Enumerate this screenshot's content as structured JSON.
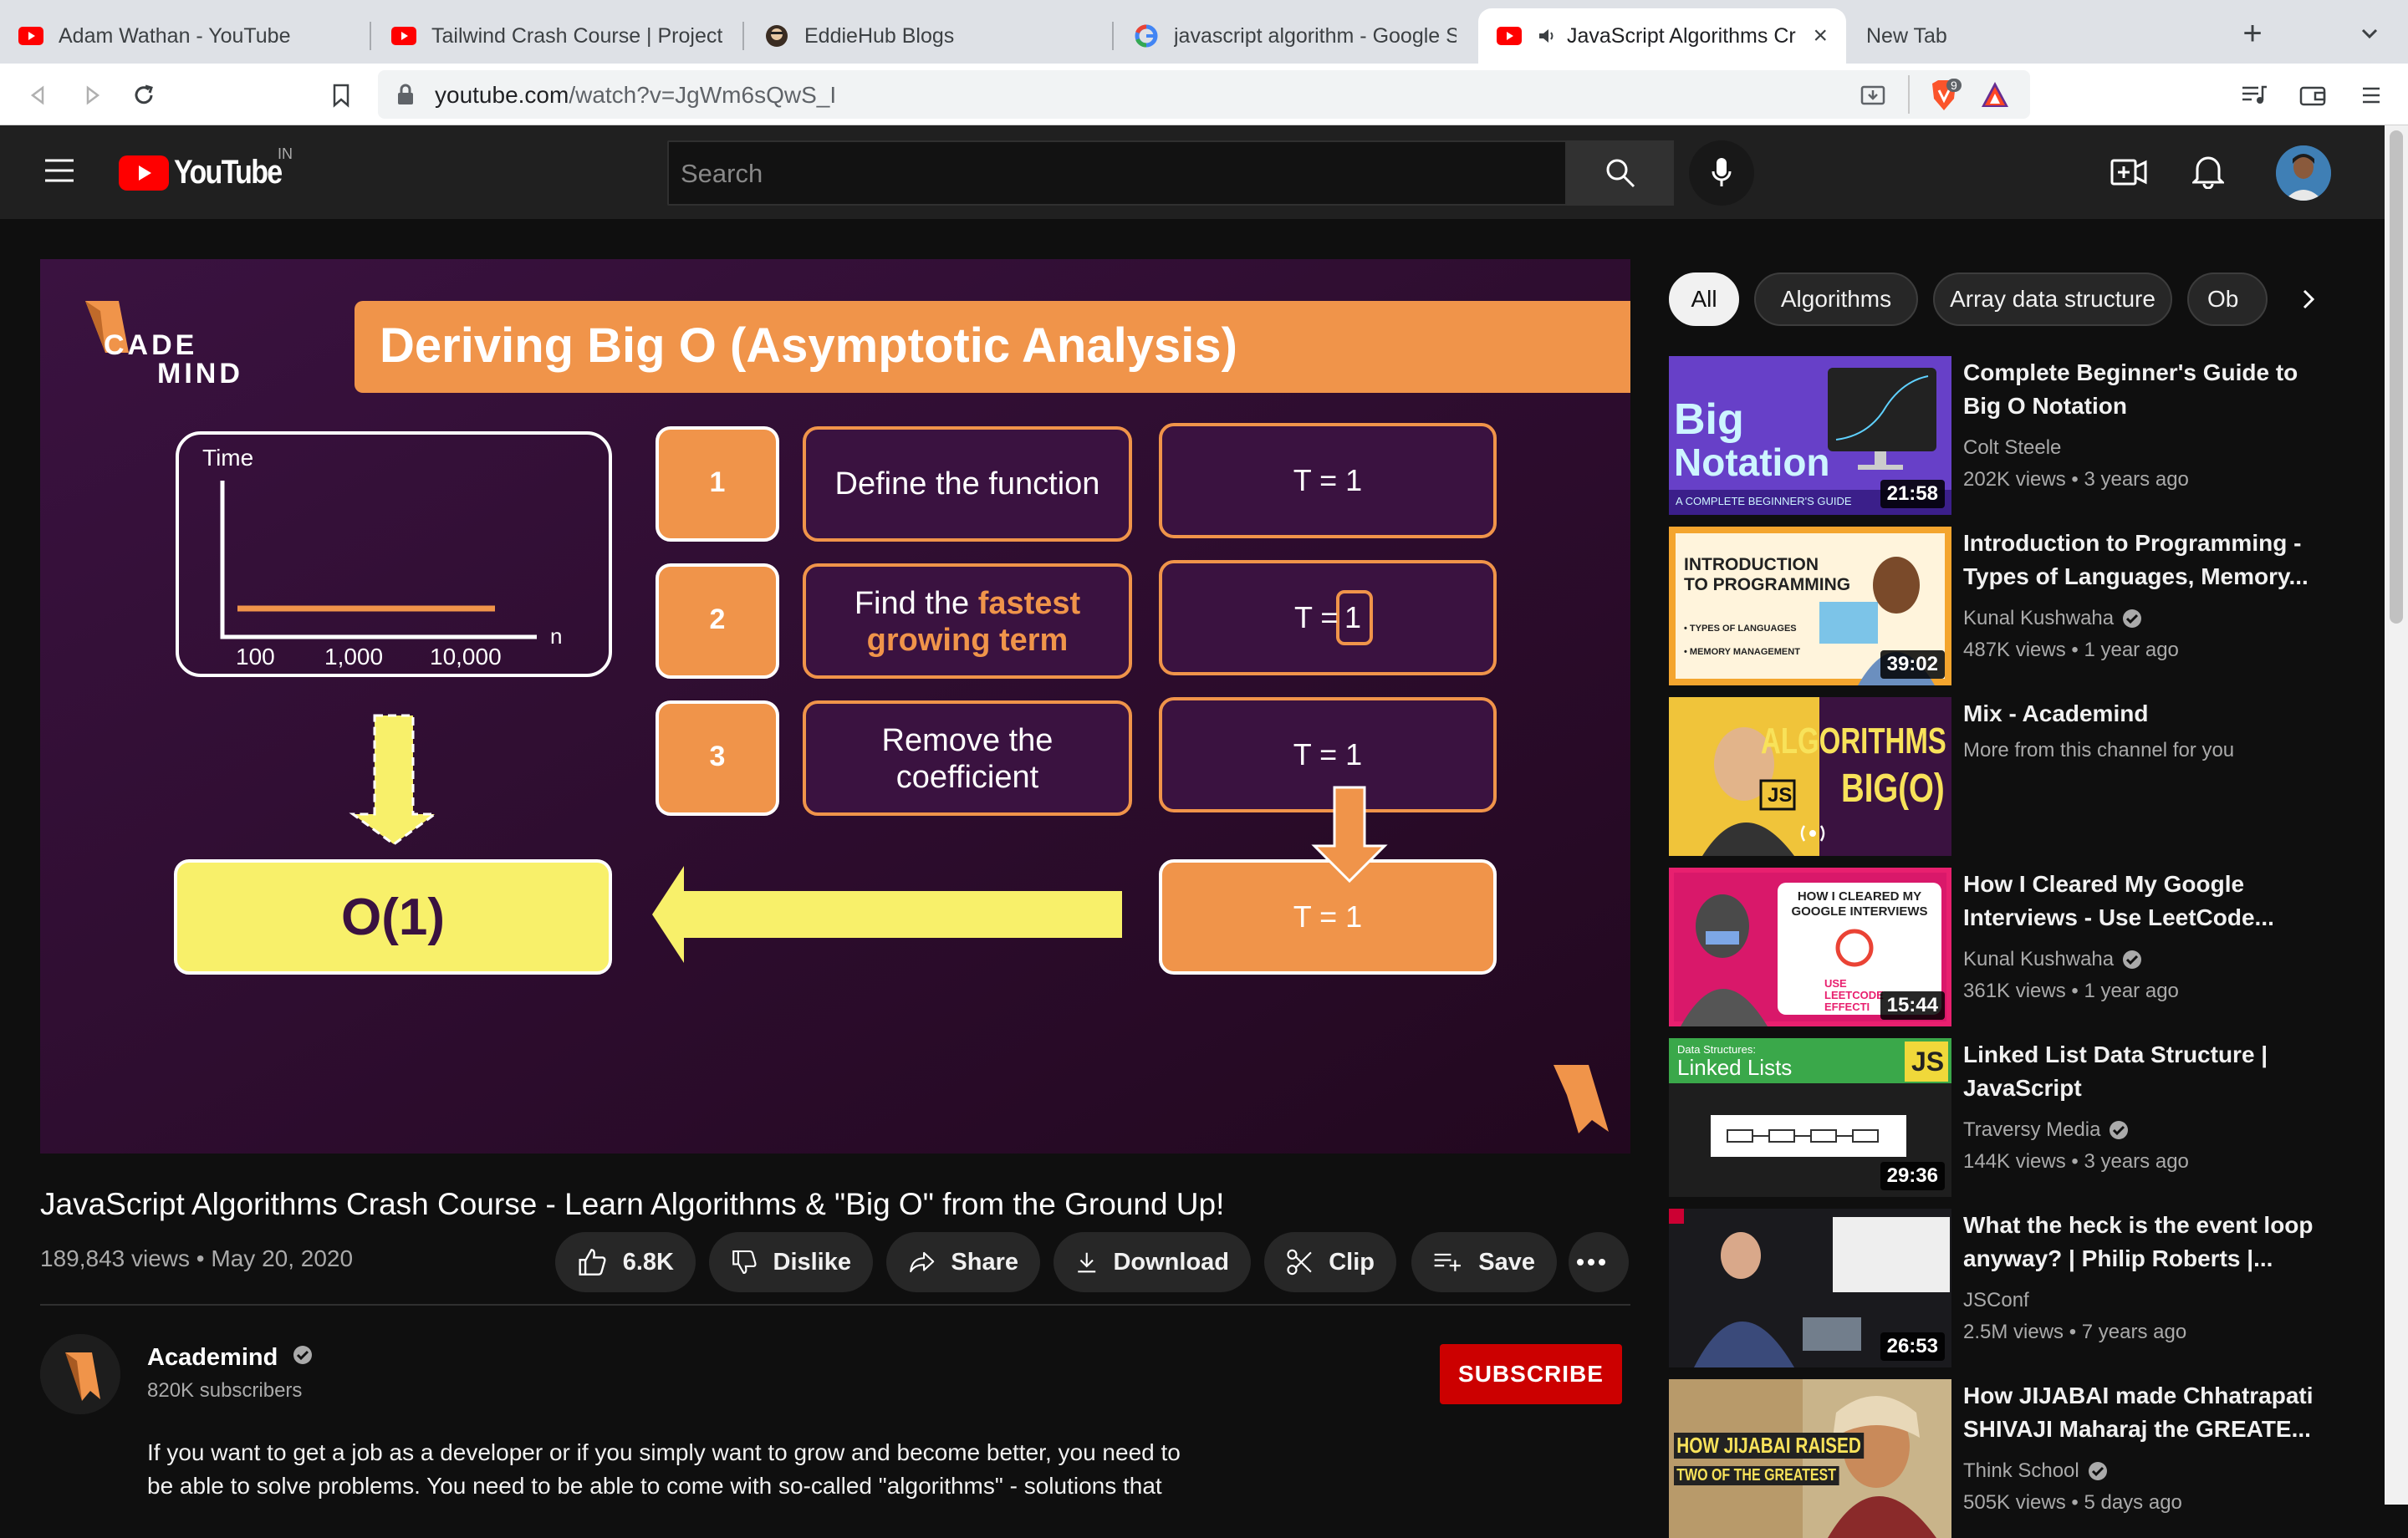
{
  "browser": {
    "tabs": [
      {
        "title": "Adam Wathan - YouTube",
        "favicon": "youtube-icon"
      },
      {
        "title": "Tailwind Crash Course | Project F",
        "favicon": "youtube-icon"
      },
      {
        "title": "EddieHub Blogs",
        "favicon": "eddiehub-icon"
      },
      {
        "title": "javascript algorithm - Google Se",
        "favicon": "google-icon"
      },
      {
        "title": "JavaScript Algorithms Cr",
        "favicon": "youtube-icon",
        "active": true,
        "audio": true
      },
      {
        "title": "New Tab",
        "favicon": ""
      }
    ],
    "url_host": "youtube.com",
    "url_path": "/watch?v=JgWm6sQwS_I",
    "shield_badge": "9"
  },
  "header": {
    "logo_text": "YouTube",
    "country": "IN",
    "search_placeholder": "Search"
  },
  "slide": {
    "brand_top": "CADE",
    "brand_bottom": "MIND",
    "title": "Deriving Big O (Asymptotic Analysis)",
    "graph_ylabel": "Time",
    "graph_xlabel": "n",
    "graph_ticks": [
      "100",
      "1,000",
      "10,000"
    ],
    "steps": [
      {
        "num": "1",
        "label_a": "Define the function",
        "label_b": "",
        "label_c": "",
        "expr": "T = 1"
      },
      {
        "num": "2",
        "label_a": "Find the ",
        "label_b": "fastest",
        "label_c": "growing term",
        "expr": "T = ",
        "expr_box": "1"
      },
      {
        "num": "3",
        "label_a": "Remove the",
        "label_b": "coefficient",
        "label_c": "",
        "expr": "T = 1"
      }
    ],
    "final_expr": "T = 1",
    "result": "O(1)"
  },
  "video": {
    "title": "JavaScript Algorithms Crash Course - Learn Algorithms & \"Big O\" from the Ground Up!",
    "views": "189,843 views",
    "date": "May 20, 2020",
    "likes": "6.8K",
    "dislike_label": "Dislike",
    "share_label": "Share",
    "download_label": "Download",
    "clip_label": "Clip",
    "save_label": "Save"
  },
  "channel": {
    "name": "Academind",
    "subscribers": "820K subscribers",
    "subscribe_label": "SUBSCRIBE"
  },
  "description": "If you want to get a job as a developer or if you simply want to grow and become better, you need to be able to solve problems. You need to be able to come with so-called \"algorithms\" - solutions that",
  "chips": [
    "All",
    "Algorithms",
    "Array data structure",
    "Ob"
  ],
  "recommendations": [
    {
      "title_1": "Complete Beginner's Guide to",
      "title_2": "Big O Notation",
      "channel": "Colt Steele",
      "verified": false,
      "meta": "202K views • 3 years ago",
      "duration": "21:58",
      "thumb_text_1": "Big",
      "thumb_text_2": "Notation",
      "thumb_text_3": "A COMPLETE BEGINNER'S GUIDE"
    },
    {
      "title_1": "Introduction to Programming -",
      "title_2": "Types of Languages, Memory...",
      "channel": "Kunal Kushwaha",
      "verified": true,
      "meta": "487K views • 1 year ago",
      "duration": "39:02",
      "thumb_text_1": "INTRODUCTION",
      "thumb_text_2": "TO PROGRAMMING",
      "thumb_text_3": "• TYPES OF LANGUAGES",
      "thumb_text_4": "• MEMORY MANAGEMENT"
    },
    {
      "title_1": "Mix - Academind",
      "title_2": "",
      "channel": "More from this channel for you",
      "verified": false,
      "meta": "",
      "duration": "",
      "thumb_text_1": "ALGORITHMS",
      "thumb_text_2": "BIG(O)",
      "thumb_text_3": "JS"
    },
    {
      "title_1": "How I Cleared My Google",
      "title_2": "Interviews - Use LeetCode...",
      "channel": "Kunal Kushwaha",
      "verified": true,
      "meta": "361K views • 1 year ago",
      "duration": "15:44",
      "thumb_text_1": "HOW I CLEARED MY",
      "thumb_text_2": "GOOGLE INTERVIEWS",
      "thumb_text_3": "USE LEETCODE EFFECTI"
    },
    {
      "title_1": "Linked List Data Structure |",
      "title_2": "JavaScript",
      "channel": "Traversy Media",
      "verified": true,
      "meta": "144K views • 3 years ago",
      "duration": "29:36",
      "thumb_text_1": "Data Structures:",
      "thumb_text_2": "Linked Lists",
      "thumb_text_3": "JS"
    },
    {
      "title_1": "What the heck is the event loop",
      "title_2": "anyway? | Philip Roberts |...",
      "channel": "JSConf",
      "verified": false,
      "meta": "2.5M views • 7 years ago",
      "duration": "26:53"
    },
    {
      "title_1": "How JIJABAI made Chhatrapati",
      "title_2": "SHIVAJI Maharaj the GREATE...",
      "channel": "Think School",
      "verified": true,
      "meta": "505K views • 5 days ago",
      "duration": "",
      "thumb_text_1": "HOW JIJABAI RAISED",
      "thumb_text_2": "TWO OF THE GREATEST"
    }
  ]
}
